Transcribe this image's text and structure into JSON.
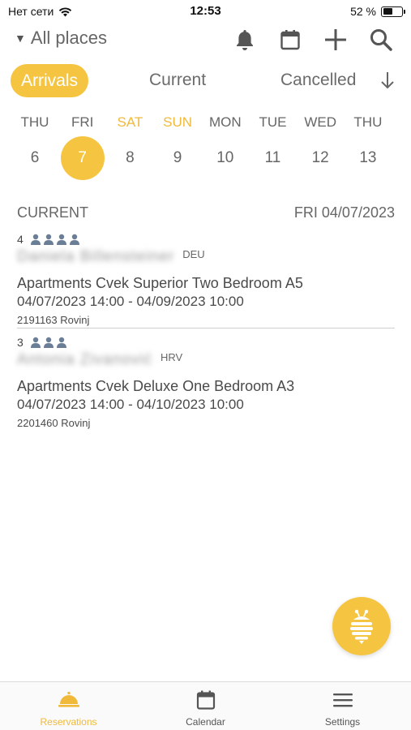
{
  "status_bar": {
    "carrier": "Нет сети",
    "time": "12:53",
    "battery_label": "52 %",
    "battery_level": 0.52
  },
  "header": {
    "places_label": "All places",
    "icons": [
      "bell-icon",
      "calendar-icon",
      "plus-icon",
      "search-icon"
    ]
  },
  "filters": {
    "arrivals": "Arrivals",
    "current": "Current",
    "cancelled": "Cancelled",
    "active": "Arrivals"
  },
  "week": [
    {
      "dow": "THU",
      "num": "6",
      "weekend": false,
      "selected": false
    },
    {
      "dow": "FRI",
      "num": "7",
      "weekend": false,
      "selected": true
    },
    {
      "dow": "SAT",
      "num": "8",
      "weekend": true,
      "selected": false
    },
    {
      "dow": "SUN",
      "num": "9",
      "weekend": true,
      "selected": false
    },
    {
      "dow": "MON",
      "num": "10",
      "weekend": false,
      "selected": false
    },
    {
      "dow": "TUE",
      "num": "11",
      "weekend": false,
      "selected": false
    },
    {
      "dow": "WED",
      "num": "12",
      "weekend": false,
      "selected": false
    },
    {
      "dow": "THU",
      "num": "13",
      "weekend": false,
      "selected": false
    }
  ],
  "section": {
    "title": "CURRENT",
    "date": "FRI 04/07/2023"
  },
  "reservations": [
    {
      "guest_count": "4",
      "guest_name": "Daniela Billensteiner",
      "country": "DEU",
      "apartment": "Apartments Cvek Superior Two Bedroom A5",
      "dates": "04/07/2023 14:00  -  04/09/2023 10:00",
      "ref": "2191163 Rovinj"
    },
    {
      "guest_count": "3",
      "guest_name": "Antonia Zivanović",
      "country": "HRV",
      "apartment": "Apartments Cvek Deluxe One Bedroom A3",
      "dates": "04/07/2023 14:00  -  04/10/2023 10:00",
      "ref": "2201460 Rovinj"
    }
  ],
  "tabbar": {
    "items": [
      {
        "label": "Reservations",
        "icon": "service-bell-icon",
        "active": true
      },
      {
        "label": "Calendar",
        "icon": "calendar-icon",
        "active": false
      },
      {
        "label": "Settings",
        "icon": "menu-icon",
        "active": false
      }
    ]
  },
  "colors": {
    "accent": "#f5c542",
    "weekend": "#f0b93a",
    "guest_icon": "#6a7f96"
  }
}
